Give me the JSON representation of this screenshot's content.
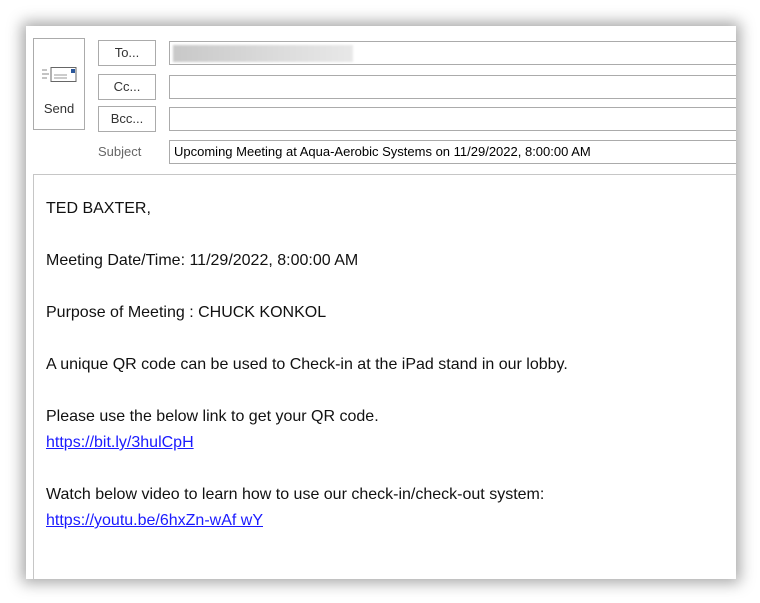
{
  "compose": {
    "send_label": "Send",
    "to_label": "To...",
    "cc_label": "Cc...",
    "bcc_label": "Bcc...",
    "subject_label": "Subject",
    "to_value": "",
    "cc_value": "",
    "bcc_value": "",
    "subject_value": "Upcoming Meeting at Aqua-Aerobic Systems on 11/29/2022, 8:00:00 AM"
  },
  "message": {
    "greeting": "TED BAXTER,",
    "meeting_datetime": "Meeting Date/Time: 11/29/2022,  8:00:00  AM",
    "purpose": "Purpose of Meeting : CHUCK KONKOL",
    "qr_info": "A unique  QR code can be used to Check-in at the iPad stand in our lobby.",
    "link_intro": "Please use the below link to get your QR code.",
    "qr_link": "https://bit.ly/3hulCpH",
    "video_intro": "Watch below video to learn how to use our check-in/check-out  system:",
    "video_link": "https://youtu.be/6hxZn-wAf wY"
  },
  "icons": {
    "send": "send-envelope-icon"
  },
  "colors": {
    "link": "#1a1aff",
    "border": "#ababab",
    "send_icon_blue": "#2b579a"
  }
}
